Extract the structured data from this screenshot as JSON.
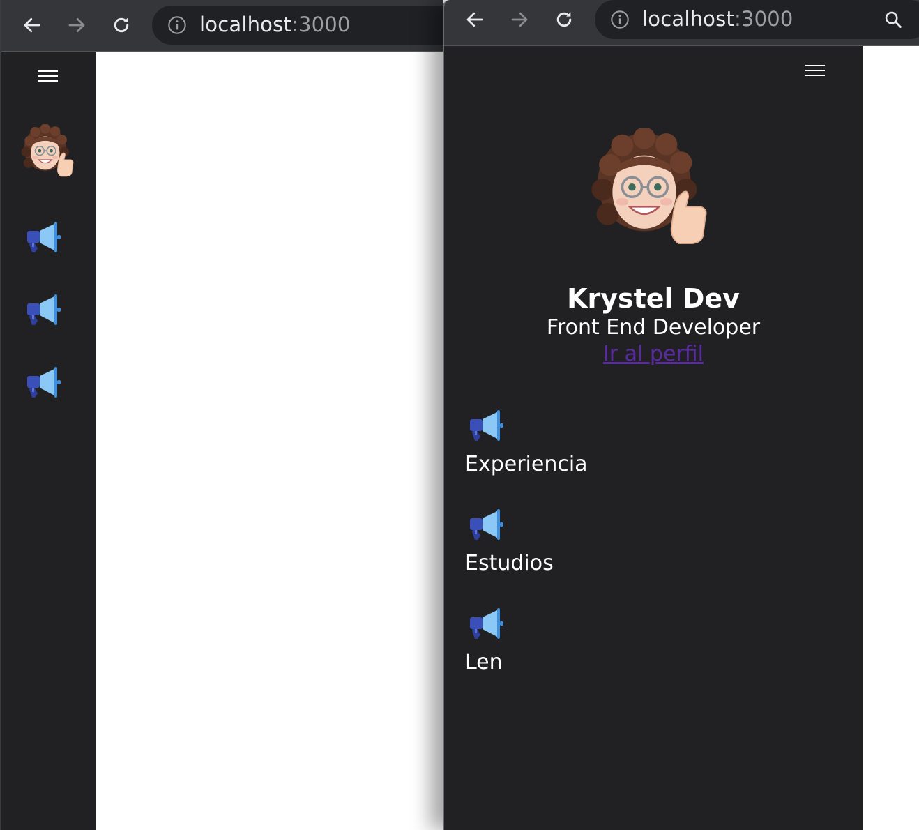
{
  "browser_left": {
    "address": {
      "host": "localhost",
      "port": ":3000"
    },
    "nav": {
      "back_icon": "arrow-left-icon",
      "forward_icon": "arrow-right-icon",
      "reload_icon": "reload-icon"
    }
  },
  "browser_right": {
    "address": {
      "host": "localhost",
      "port": ":3000"
    },
    "nav": {
      "back_icon": "arrow-left-icon",
      "forward_icon": "arrow-right-icon",
      "reload_icon": "reload-icon",
      "search_icon": "search-icon"
    }
  },
  "sidebar_collapsed": {
    "menu_icon": "hamburger-icon",
    "avatar": "memoji-avatar",
    "items": [
      {
        "icon": "megaphone-icon"
      },
      {
        "icon": "megaphone-icon"
      },
      {
        "icon": "megaphone-icon"
      }
    ]
  },
  "sidebar_expanded": {
    "menu_icon": "hamburger-icon",
    "avatar": "memoji-avatar",
    "profile": {
      "name": "Krystel Dev",
      "role": "Front End Developer",
      "link_label": "Ir al perfil"
    },
    "items": [
      {
        "icon": "megaphone-icon",
        "label": "Experiencia"
      },
      {
        "icon": "megaphone-icon",
        "label": "Estudios"
      },
      {
        "icon": "megaphone-icon",
        "label": "Len"
      }
    ]
  },
  "colors": {
    "toolbar": "#35363a",
    "omnibox": "#202124",
    "sidebar": "#212123",
    "link": "#5a2aa0",
    "megaphone_dark": "#3b4fb8",
    "megaphone_light": "#8cc8f5"
  }
}
